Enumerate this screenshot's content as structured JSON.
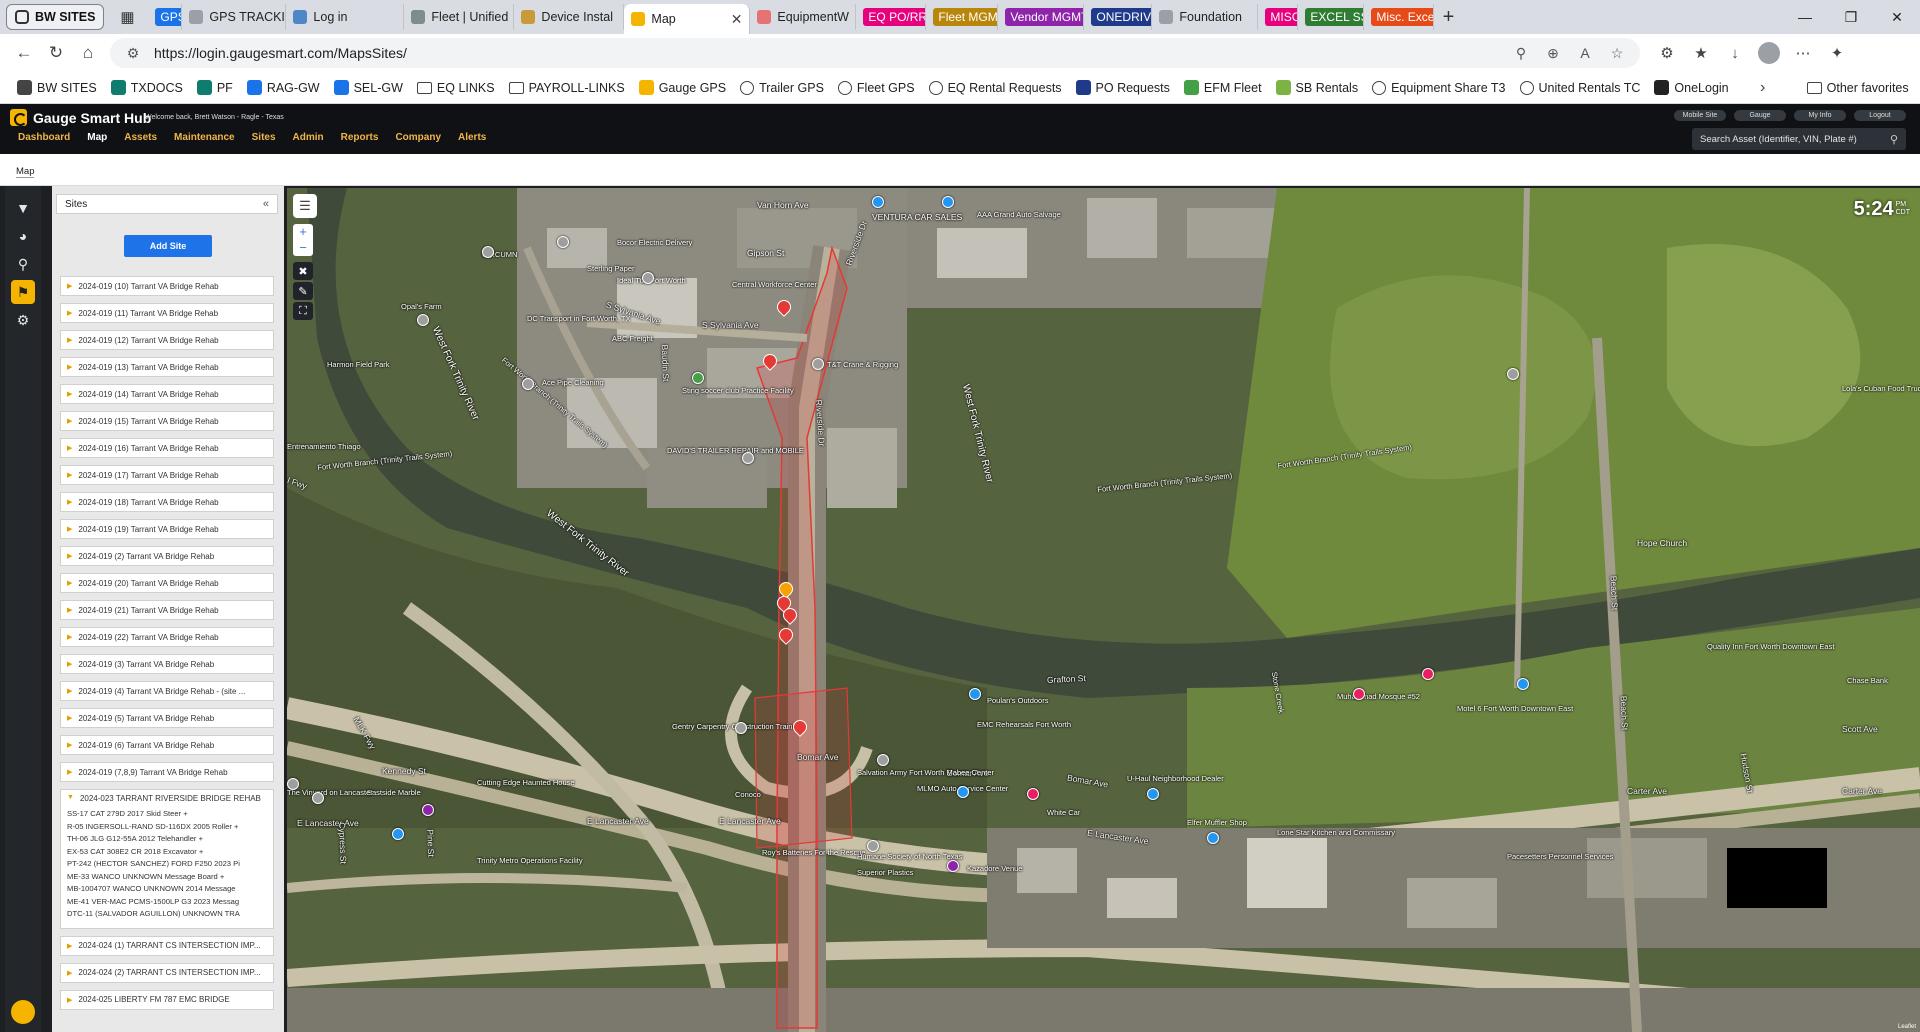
{
  "browser": {
    "workspace_label": "BW SITES",
    "tabs": [
      {
        "label": "GPS",
        "chip_color": "#1a73e8",
        "is_chip": true
      },
      {
        "label": "GPS TRACKIN",
        "icon": "globe-icon"
      },
      {
        "label": "Log in",
        "icon": "my-icon"
      },
      {
        "label": "Fleet | Unified",
        "icon": "fleet-icon"
      },
      {
        "label": "Device Instal",
        "icon": "device-icon"
      },
      {
        "label": "Map",
        "icon": "gauge-icon",
        "active": true
      },
      {
        "label": "EquipmentW",
        "icon": "equip-icon"
      },
      {
        "label": "EQ PO/RR'S",
        "chip_color": "#e6007e",
        "is_chip": true
      },
      {
        "label": "Fleet MGMT",
        "chip_color": "#b8860b",
        "is_chip": true
      },
      {
        "label": "Vendor MGMT",
        "chip_color": "#8e24aa",
        "is_chip": true
      },
      {
        "label": "ONEDRIVE",
        "chip_color": "#1f3a8a",
        "is_chip": true
      },
      {
        "label": "Foundation",
        "icon": "globe-icon"
      },
      {
        "label": "MISC",
        "chip_color": "#e6007e",
        "is_chip": true
      },
      {
        "label": "EXCEL SS'S",
        "chip_color": "#2e7d32",
        "is_chip": true
      },
      {
        "label": "Misc. Excel",
        "chip_color": "#e64a19",
        "is_chip": true
      }
    ],
    "url": "https://login.gaugesmart.com/MapsSites/",
    "favorites": [
      {
        "label": "BW SITES",
        "icon": "workspace-icon"
      },
      {
        "label": "TXDOCS",
        "icon": "txdocs-icon"
      },
      {
        "label": "PF",
        "icon": "pf-icon"
      },
      {
        "label": "RAG-GW",
        "icon": "g-icon"
      },
      {
        "label": "SEL-GW",
        "icon": "g-icon"
      },
      {
        "label": "EQ LINKS",
        "icon": "folder-icon"
      },
      {
        "label": "PAYROLL-LINKS",
        "icon": "folder-icon"
      },
      {
        "label": "Gauge GPS",
        "icon": "gauge-icon"
      },
      {
        "label": "Trailer GPS",
        "icon": "globe-icon"
      },
      {
        "label": "Fleet GPS",
        "icon": "globe-icon"
      },
      {
        "label": "EQ Rental Requests",
        "icon": "globe-icon"
      },
      {
        "label": "PO Requests",
        "icon": "po-icon"
      },
      {
        "label": "EFM Fleet",
        "icon": "efm-icon"
      },
      {
        "label": "SB Rentals",
        "icon": "sb-icon"
      },
      {
        "label": "Equipment Share T3",
        "icon": "globe-icon"
      },
      {
        "label": "United Rentals TC",
        "icon": "globe-icon"
      },
      {
        "label": "OneLogin",
        "icon": "onelogin-icon"
      }
    ],
    "other_favorites": "Other favorites"
  },
  "app": {
    "title": "Gauge Smart Hub",
    "welcome": "Welcome back, Brett Watson - Ragle - Texas",
    "nav": [
      "Dashboard",
      "Map",
      "Assets",
      "Maintenance",
      "Sites",
      "Admin",
      "Reports",
      "Company",
      "Alerts"
    ],
    "current_nav": "Map",
    "top_buttons": [
      "Mobile Site",
      "Gauge",
      "My Info",
      "Logout"
    ],
    "search_placeholder": "Search Asset (Identifier, VIN, Plate #)",
    "breadcrumb": "Map"
  },
  "sites_panel": {
    "title": "Sites",
    "add_button": "Add Site",
    "sites": [
      "2024-019 (10) Tarrant VA Bridge Rehab",
      "2024-019 (11) Tarrant VA Bridge Rehab",
      "2024-019 (12) Tarrant VA Bridge Rehab",
      "2024-019 (13) Tarrant VA Bridge Rehab",
      "2024-019 (14) Tarrant VA Bridge Rehab",
      "2024-019 (15) Tarrant VA Bridge Rehab",
      "2024-019 (16) Tarrant VA Bridge Rehab",
      "2024-019 (17) Tarrant VA Bridge Rehab",
      "2024-019 (18) Tarrant VA Bridge Rehab",
      "2024-019 (19) Tarrant VA Bridge Rehab",
      "2024-019 (2) Tarrant VA Bridge Rehab",
      "2024-019 (20) Tarrant VA Bridge Rehab",
      "2024-019 (21) Tarrant VA Bridge Rehab",
      "2024-019 (22) Tarrant VA Bridge Rehab",
      "2024-019 (3) Tarrant VA Bridge Rehab",
      "2024-019 (4) Tarrant VA Bridge Rehab - (site ...",
      "2024-019 (5) Tarrant VA Bridge Rehab",
      "2024-019 (6) Tarrant VA Bridge Rehab",
      "2024-019 (7,8,9) Tarrant VA Bridge Rehab"
    ],
    "expanded_site": {
      "name": "2024-023 TARRANT RIVERSIDE BRIDGE REHAB",
      "assets": [
        "SS-17 CAT 279D 2017 Skid Steer +",
        "R-05 INGERSOLL-RAND SD-116DX 2005 Roller +",
        "TH-06 JLG G12-55A 2012 Telehandler +",
        "EX-53 CAT 308E2 CR 2018 Excavator +",
        "PT-242 (HECTOR SANCHEZ) FORD F250 2023 Pi",
        "ME-33 WANCO UNKNOWN Message Board +",
        "MB-1004707 WANCO UNKNOWN 2014 Message",
        "ME-41 VER-MAC PCMS-1500LP G3 2023 Messag",
        "DTC-11 (SALVADOR AGUILLON) UNKNOWN TRA"
      ]
    },
    "after_sites": [
      "2024-024 (1) TARRANT CS INTERSECTION IMP...",
      "2024-024 (2) TARRANT CS INTERSECTION IMP...",
      "2024-025 LIBERTY FM 787 EMC BRIDGE"
    ]
  },
  "map": {
    "time": "5:24",
    "ampm_top": "PM",
    "ampm_bottom": "CDT",
    "attribution": "Leaflet",
    "labels": {
      "van_horn": "Van Horn Ave",
      "ventura": "VENTURA CAR SALES",
      "aaa": "AAA Grand Auto Salvage",
      "bocor": "Bocor Electric Delivery",
      "gipson": "Gipson St",
      "cubmn": "CIRCUMN",
      "sterling": "Sterling Paper",
      "ideal_turf": "Ideal Turf Fort Worth",
      "central_wf": "Central Workforce Center",
      "sylvania": "S Sylvania Ave",
      "ssylvania2": "S Sylvania Ave",
      "dc_transport": "DC Transport in Fort Worth, TX",
      "abc_freight": "ABC Freight",
      "opals_farm": "Opal's Farm",
      "harmon": "Harmon Field Park",
      "west_fork1": "West Fork Trinity River",
      "west_fork2": "West Fork Trinity River",
      "west_fork3": "West Fork Trinity River",
      "ace_pipe": "Ace Pipe Cleaning",
      "sting_soccer": "Sting soccer club Practice Facility",
      "ttr_crane": "T&T Crane & Rigging",
      "davids": "DAVID'S TRAILER REPAIR and MOBILE",
      "entrenamiento": "Entrenamiento Thiago",
      "fw_branch1": "Fort Worth Branch (Trinity Trails System)",
      "fw_branch2": "Fort Worth Branch (Trinity Trails System)",
      "fw_branch3": "Fort Worth Branch (Trinity Trails System)",
      "fw_branch4": "Fort Worth Branch (Trinity Trails System)",
      "lolas": "Lola's Cuban Food Truck",
      "hope_church": "Hope Church",
      "quality_inn": "Quality Inn Fort Worth Downtown East",
      "grafton": "Grafton St",
      "gentry": "Gentry Carpentry Construction Training",
      "bomar": "Bomar Ave",
      "bomar2": "Bomar Ave",
      "bomar3": "Bomar Ave",
      "salvation": "Salvation Army Fort Worth Mabee Center",
      "muhammad": "Muhammad Mosque #52",
      "motel6": "Motel 6 Fort Worth Downtown East",
      "scott": "Scott Ave",
      "carter": "Carter Ave",
      "carter2": "Carter Ave",
      "lancaster1": "E Lancaster Ave",
      "lancaster2": "E Lancaster Ave",
      "lancaster3": "E Lancaster Ave",
      "lancaster4": "E Lancaster Ave",
      "kennedy": "Kennedy St",
      "eastside": "Eastside Marble",
      "cutting_edge": "Cutting Edge Haunted House",
      "vinyard": "The Vinyard on Lancaster",
      "trinity_metro": "Trinity Metro Operations Facility",
      "royal_batteries": "Roy's Batteries For the Rescue",
      "humane": "Humane Society of North Texas",
      "uhaul": "U-Haul Neighborhood Dealer",
      "elfer": "Elfer Muffler Shop",
      "lone_star": "Lone Star Kitchen and Commissary",
      "paceseters": "Pacesetters Personnel Services",
      "chase": "Chase Bank",
      "kazadore": "Kazadore Venue",
      "superior": "Superior Plastics",
      "conoco": "Conoco",
      "mlmo": "MLMO Auto Service Center",
      "emc_rehearsals": "EMC Rehearsals Fort Worth",
      "poulanes": "Poulan's Outdoors",
      "white_car": "White Car",
      "riverside_dr": "Riverside Dr",
      "riverside_dr2": "Riverside Dr",
      "baudin": "Baudin St",
      "beach": "Beach St",
      "beach2": "Beach St",
      "hudson": "Hudson St",
      "pine": "Pine St",
      "cypress": "Cypress St",
      "stone_creek": "Stone Creek",
      "mlk_fwy": "MLK Fwy",
      "ifwy": "I Fwy"
    }
  }
}
